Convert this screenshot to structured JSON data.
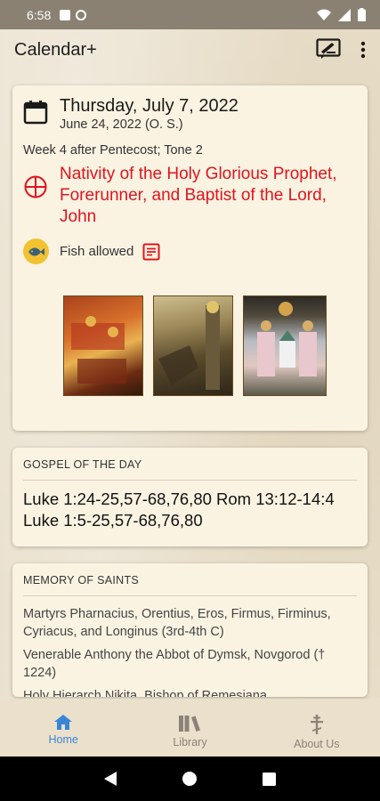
{
  "status_bar": {
    "time": "6:58"
  },
  "app_bar": {
    "title": "Calendar+"
  },
  "date_card": {
    "date": "Thursday, July 7, 2022",
    "old_style_date": "June 24, 2022 (O. S.)",
    "week": "Week 4 after Pentecost; Tone 2",
    "feast": "Nativity of the Holy Glorious Prophet, Forerunner, and Baptist of the Lord, John",
    "fast": "Fish allowed"
  },
  "gospel": {
    "header": "GOSPEL OF THE DAY",
    "text": "Luke 1:24-25,57-68,76,80 Rom 13:12-14:4 Luke 1:5-25,57-68,76,80"
  },
  "memory": {
    "header": "MEMORY OF SAINTS",
    "saints": [
      "Martyrs Pharnacius, Orentius, Eros, Firmus, Firminus, Cyriacus, and Longinus (3rd-4th C)",
      "Venerable Anthony the Abbot of Dymsk, Novgorod († 1224)",
      "Holy Hierarch Nikita, Bishop of Remesiana"
    ]
  },
  "bottom_nav": [
    {
      "label": "Home",
      "active": true
    },
    {
      "label": "Library",
      "active": false
    },
    {
      "label": "About Us",
      "active": false
    }
  ],
  "colors": {
    "feast_red": "#e0141e",
    "active_blue": "#3a86d6",
    "card_bg": "#fbf3e2"
  }
}
